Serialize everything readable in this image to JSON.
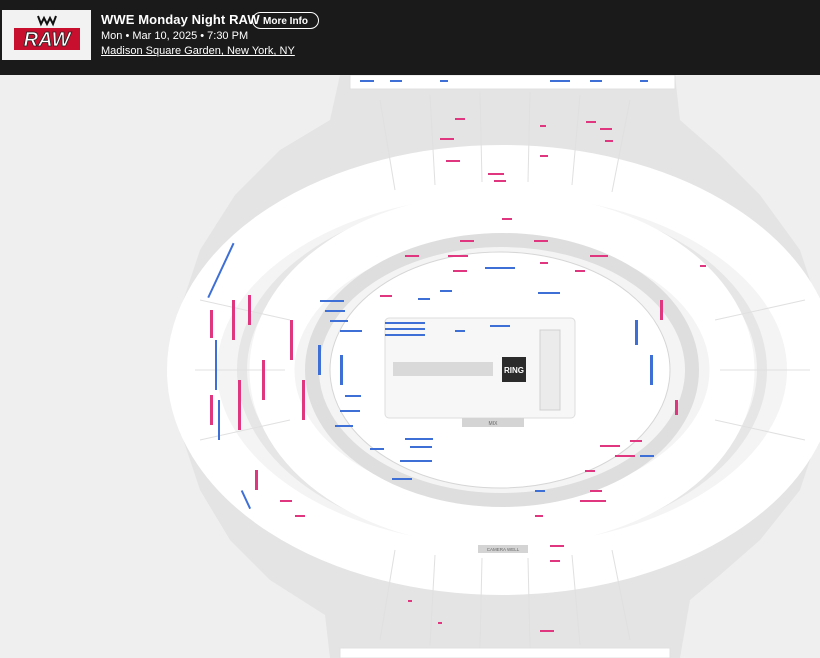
{
  "event": {
    "title": "WWE Monday Night RAW",
    "more_info_label": "More Info",
    "date_line": "Mon • Mar 10, 2025 • 7:30 PM",
    "venue_line": "Madison Square Garden, New York, NY",
    "logo_text": "RAW"
  },
  "map": {
    "ring_label": "RING",
    "mix_label": "MIX",
    "camera_label": "CAMERA WELL"
  },
  "colors": {
    "header_bg": "#1a1a1a",
    "map_bg": "#efefef",
    "seat_pink": "#e0357f",
    "seat_blue": "#3d6fd6",
    "ring": "#2b2b2b"
  }
}
